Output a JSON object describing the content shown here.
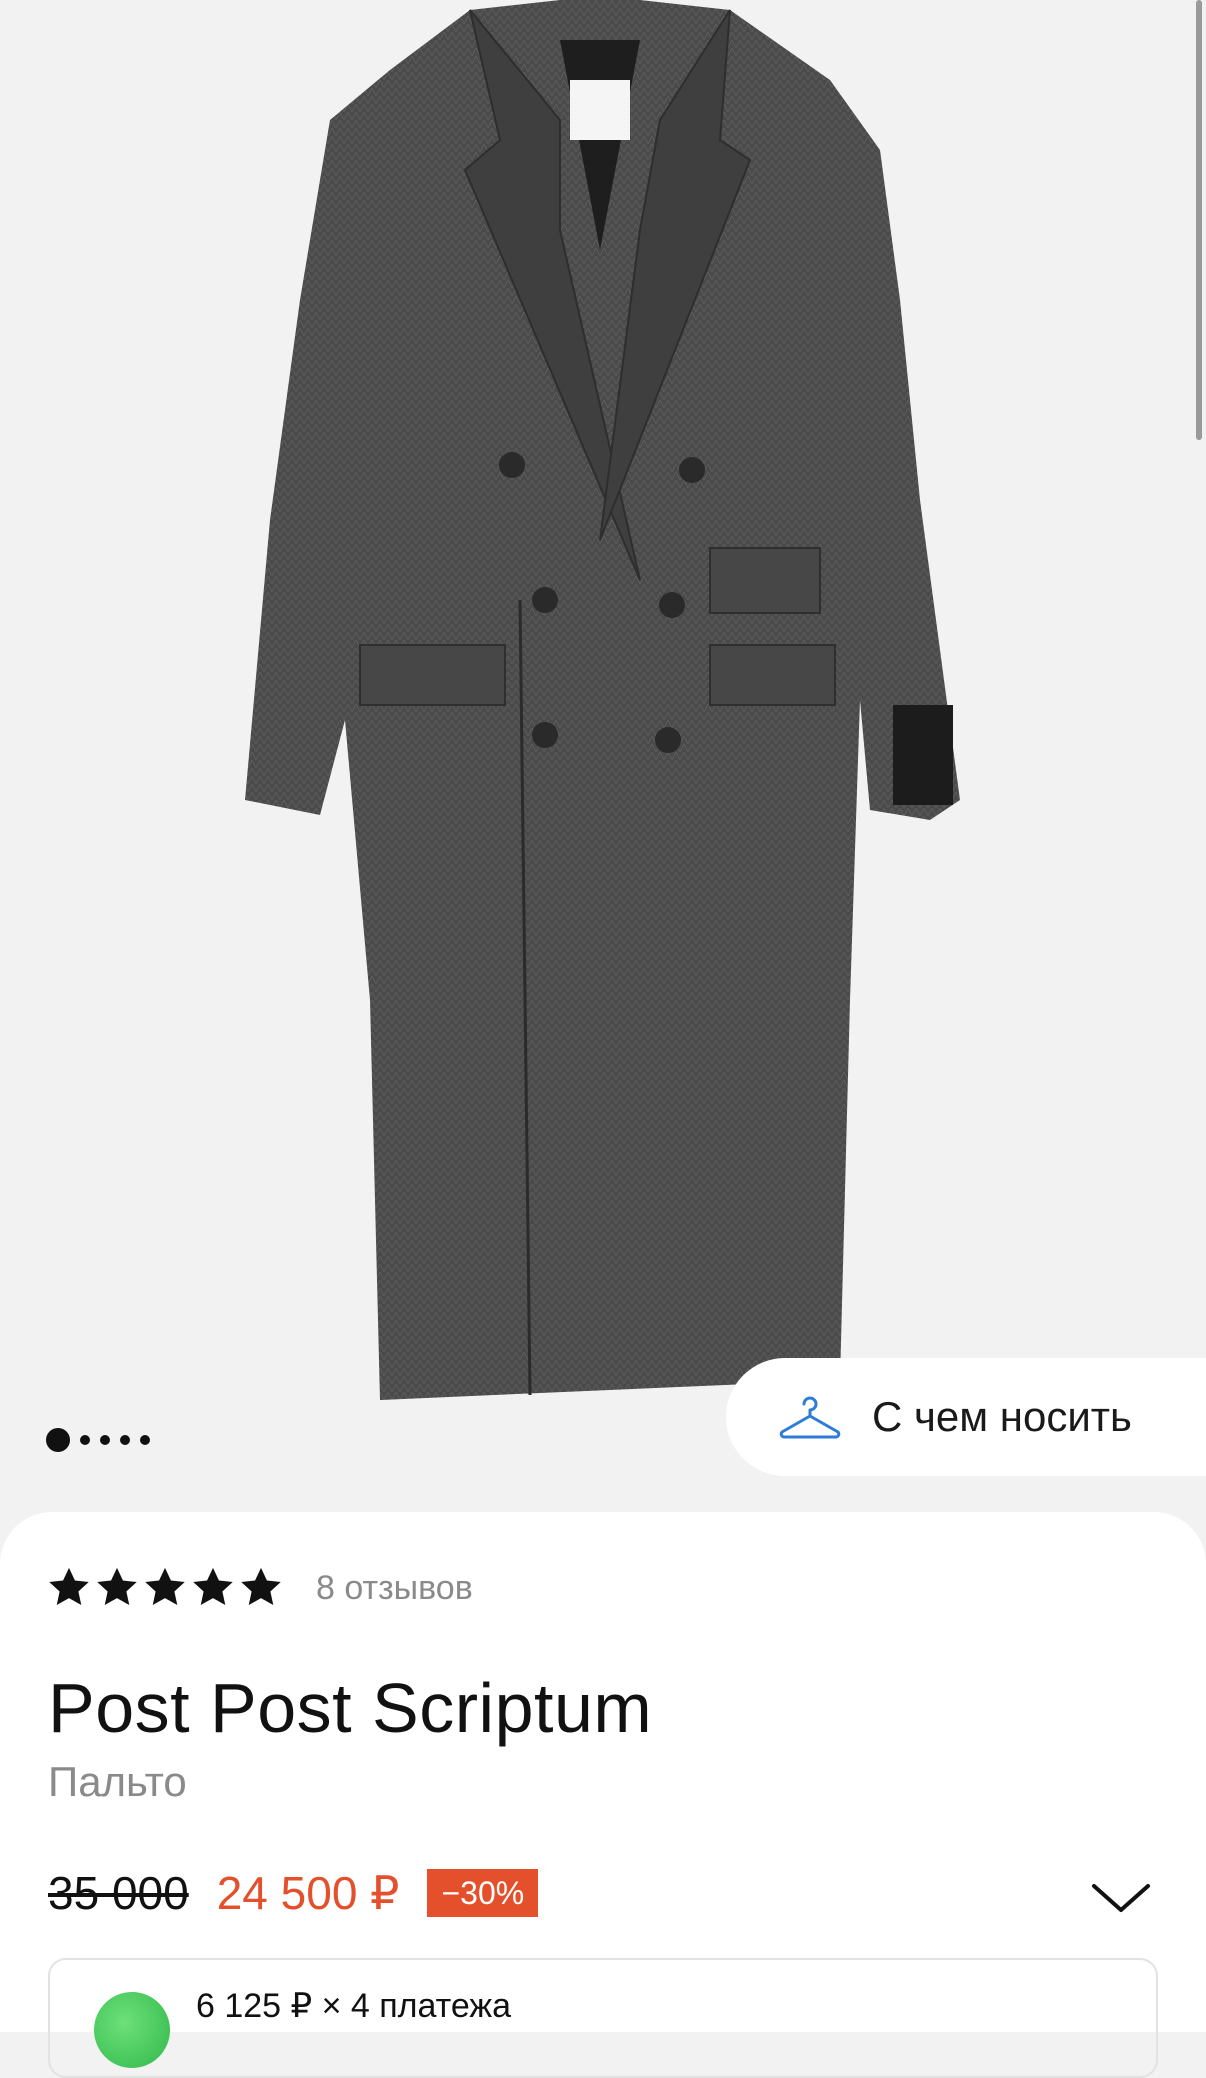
{
  "gallery": {
    "image_alt": "Пальто Post Post Scriptum",
    "total_images": 5,
    "active_index": 0
  },
  "wear_button": {
    "label": "С чем носить",
    "icon": "hanger-icon"
  },
  "product": {
    "rating_stars": 5,
    "reviews": "8 отзывов",
    "brand": "Post Post Scriptum",
    "category": "Пальто",
    "old_price": "35 000",
    "new_price": "24 500 ₽",
    "discount": "−30%"
  },
  "installment": {
    "text": "6 125 ₽ × 4 платежа"
  },
  "colors": {
    "accent": "#e3502b",
    "muted": "#8a8a8a",
    "icon_blue": "#2f7cd6"
  }
}
